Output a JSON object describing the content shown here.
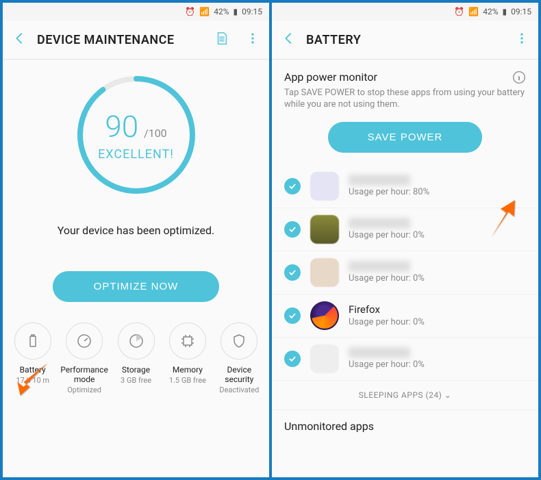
{
  "statusbar": {
    "battery": "42%",
    "time": "09:15"
  },
  "left": {
    "title": "DEVICE MAINTENANCE",
    "score": "90",
    "score_of": "/100",
    "score_label": "EXCELLENT!",
    "optimized_msg": "Your device has been optimized.",
    "optimize_btn": "OPTIMIZE NOW",
    "cats": [
      {
        "label": "Battery",
        "sub": "17 h 10 m"
      },
      {
        "label": "Performance mode",
        "sub": "Optimized"
      },
      {
        "label": "Storage",
        "sub": "3 GB free"
      },
      {
        "label": "Memory",
        "sub": "1.5 GB free"
      },
      {
        "label": "Device security",
        "sub": "Deactivated"
      }
    ]
  },
  "right": {
    "title": "BATTERY",
    "section_title": "App power monitor",
    "section_sub": "Tap SAVE POWER to stop these apps from using your battery while you are not using them.",
    "save_btn": "SAVE POWER",
    "apps": [
      {
        "name": "",
        "usage": "Usage per hour: 80%",
        "blurred": true
      },
      {
        "name": "",
        "usage": "Usage per hour: 0%",
        "blurred": true
      },
      {
        "name": "",
        "usage": "Usage per hour: 0%",
        "blurred": true
      },
      {
        "name": "Firefox",
        "usage": "Usage per hour: 0%",
        "blurred": false
      },
      {
        "name": "",
        "usage": "Usage per hour: 0%",
        "blurred": true
      }
    ],
    "sleeping": "SLEEPING APPS (24)",
    "unmonitored": "Unmonitored apps"
  }
}
